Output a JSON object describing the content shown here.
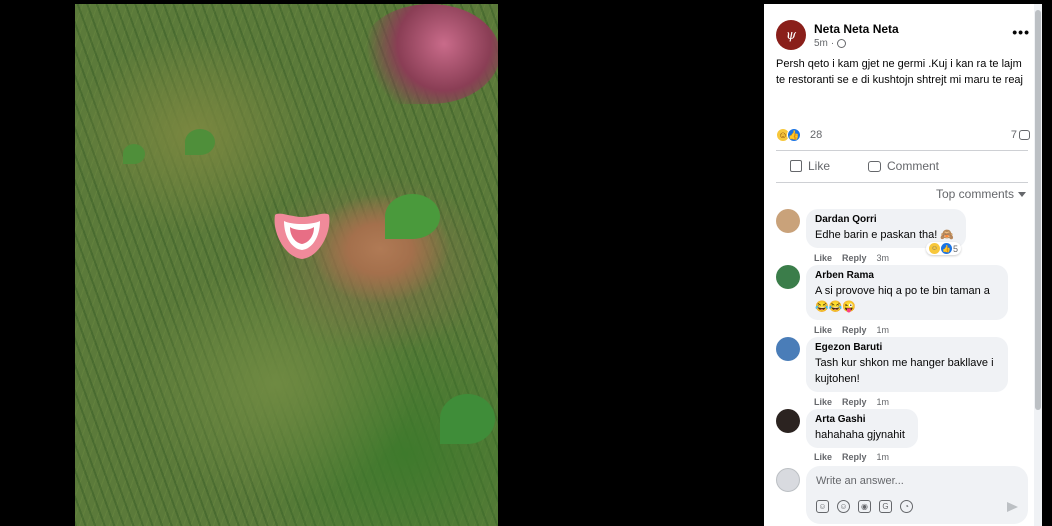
{
  "post": {
    "author": "Neta Neta Neta",
    "time": "5m",
    "text": "Persh qeto i kam gjet ne germi .Kuj i kan ra te lajm te restoranti se e di kushtojn shtrejt mi maru te reaj",
    "reaction_count": "28",
    "comment_count": "7",
    "more_icon": "more-horizontal-icon",
    "photo_alt": "photo"
  },
  "actions": {
    "like_label": "Like",
    "comment_label": "Comment"
  },
  "sort": {
    "label": "Top comments"
  },
  "comments": [
    {
      "name": "Dardan Qorri",
      "text": "Edhe barin e paskan tha! 🙈",
      "like": "Like",
      "reply": "Reply",
      "time": "3m",
      "reaction_count": "5",
      "avatar_color": "#c9a27a"
    },
    {
      "name": "Arben Rama",
      "text": "A si provove hiq a po te bin taman a",
      "line2": "😂😂😜",
      "like": "Like",
      "reply": "Reply",
      "time": "1m",
      "avatar_color": "#3b7d4a"
    },
    {
      "name": "Egezon Baruti",
      "text": "Tash kur shkon me hanger bakllave i kujtohen!",
      "like": "Like",
      "reply": "Reply",
      "time": "1m",
      "avatar_color": "#4a7db8"
    },
    {
      "name": "Arta Gashi",
      "text": "hahahaha gjynahit",
      "like": "Like",
      "reply": "Reply",
      "time": "1m",
      "avatar_color": "#2b2320"
    }
  ],
  "composer": {
    "placeholder": "Write an answer...",
    "tools": [
      "avatar-sticker-icon",
      "emoji-icon",
      "camera-icon",
      "gif-icon",
      "sticker-icon"
    ],
    "send_icon": "send-icon"
  },
  "colors": {
    "accent": "#1b74e4",
    "text_secondary": "#65676b",
    "bubble_bg": "#f0f2f5"
  }
}
